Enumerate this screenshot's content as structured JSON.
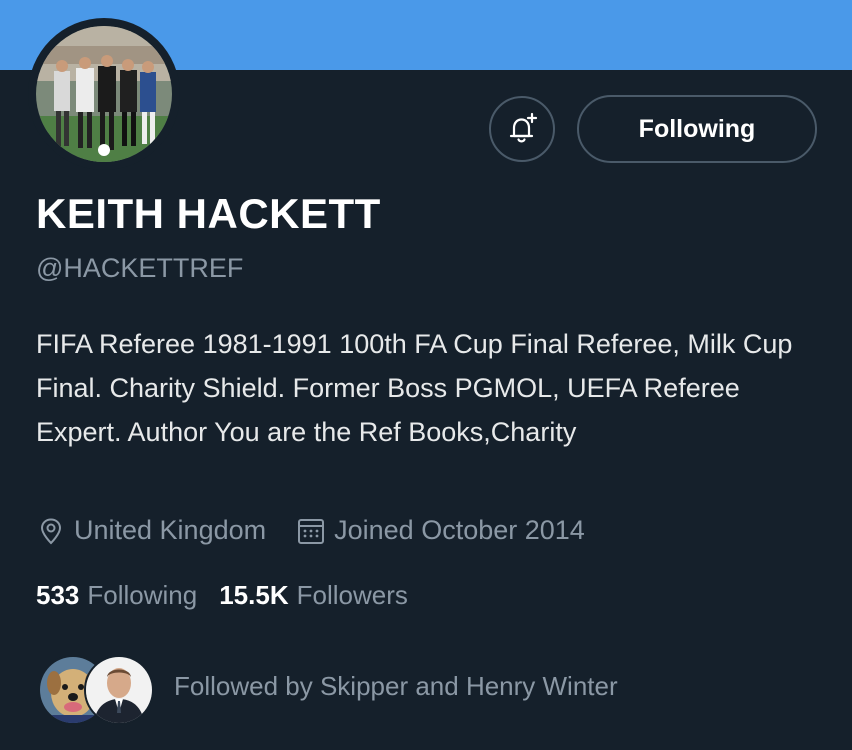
{
  "colors": {
    "banner": "#4a99e9",
    "background": "#15202b",
    "muted_text": "#8b98a5",
    "border": "#4a5a69"
  },
  "profile": {
    "name": "KEITH HACKETT",
    "handle": "@HACKETTREF",
    "bio": "FIFA Referee 1981-1991 100th FA Cup Final Referee, Milk Cup Final. Charity Shield. Former Boss PGMOL, UEFA Referee Expert. Author You are the Ref Books,Charity",
    "location": "United Kingdom",
    "joined": "Joined October 2014",
    "location_icon": "location-pin-icon",
    "calendar_icon": "calendar-icon"
  },
  "actions": {
    "notify_icon": "bell-plus-icon",
    "follow_label": "Following"
  },
  "stats": {
    "following_count": "533",
    "following_label": "Following",
    "followers_count": "15.5K",
    "followers_label": "Followers"
  },
  "followed_by": {
    "text": "Followed by Skipper and Henry Winter"
  }
}
